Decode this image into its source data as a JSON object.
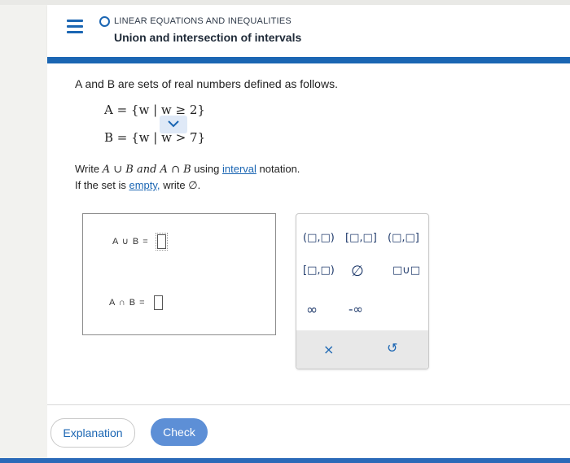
{
  "header": {
    "topic": "LINEAR EQUATIONS AND INEQUALITIES",
    "title": "Union and intersection of intervals"
  },
  "problem": {
    "intro": "A and B are sets of real numbers defined as follows.",
    "setA": "A = {w | w ≥ 2}",
    "setB": "B = {w | w > 7}",
    "instruction1_pre": "Write",
    "instruction1_math": "A ∪ B and A ∩ B",
    "instruction1_mid": "using",
    "instruction1_link": "interval",
    "instruction1_post": "notation.",
    "instruction2_pre": "If the set is",
    "instruction2_link": "empty,",
    "instruction2_post": "write ∅."
  },
  "answers": {
    "union_label": "A ∪ B =",
    "intersection_label": "A ∩ B ="
  },
  "keypad": {
    "open_open": "(□,□)",
    "closed_closed": "[□,□]",
    "open_closed": "(□,□]",
    "closed_open": "[□,□)",
    "empty_set": "∅",
    "union": "□∪□",
    "infinity": "∞",
    "neg_infinity": "-∞",
    "clear": "×",
    "undo": "↺"
  },
  "footer": {
    "explanation": "Explanation",
    "check": "Check"
  },
  "colors": {
    "accent": "#1b66b3",
    "check_button": "#5d8fd6"
  }
}
